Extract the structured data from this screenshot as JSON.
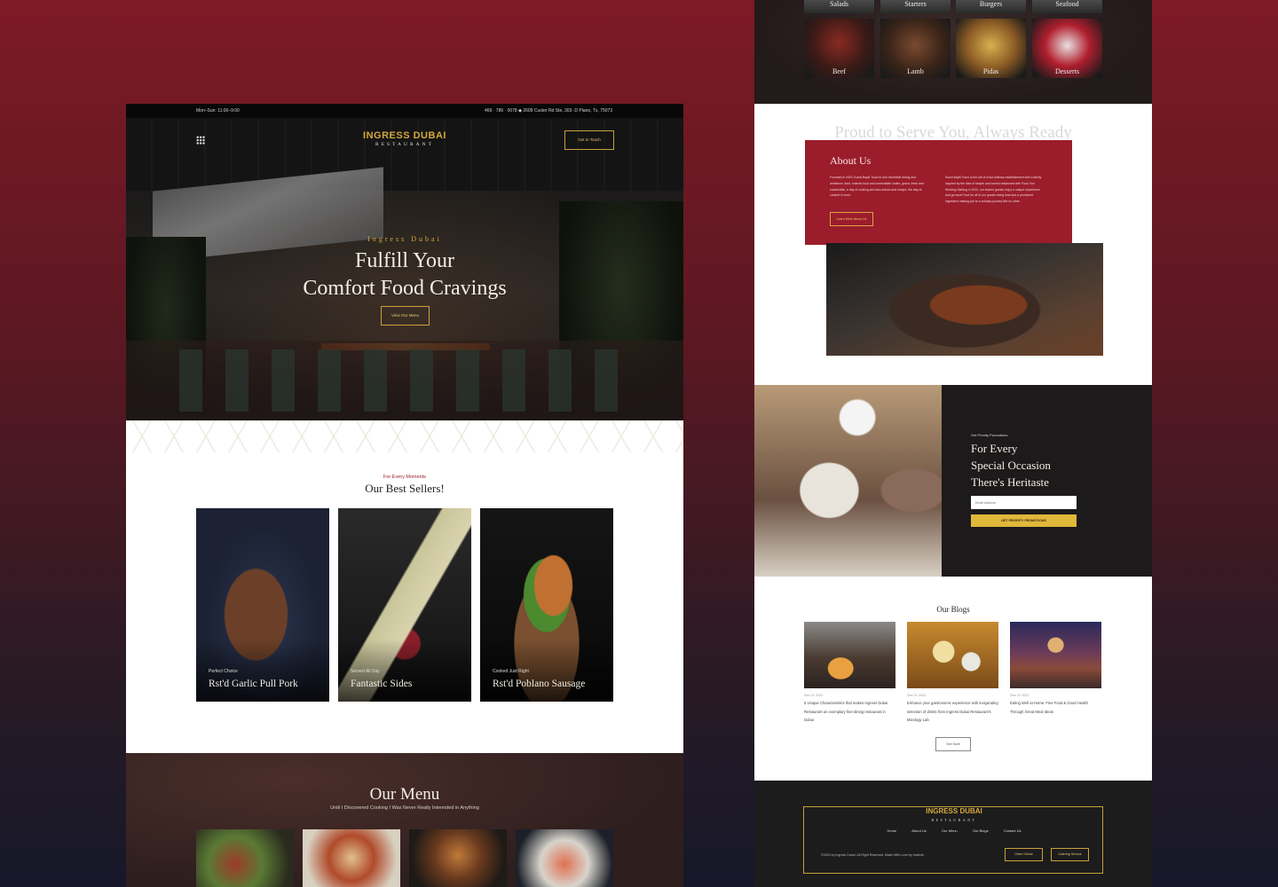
{
  "left_page": {
    "topbar": {
      "hours": "Mon–Sun: 11:00–9:00",
      "contact": "469 · 786 · 0078   ◆   2609 Custer Rd Ste, 303 ·D Plano, Tx, 75073"
    },
    "logo": {
      "name": "INGRESS DUBAI",
      "sub": "RESTAURANT"
    },
    "header_button": "Get In Touch",
    "hero": {
      "kicker": "Ingress Dubai",
      "title_line1": "Fulfill Your",
      "title_line2": "Comfort Food Cravings",
      "button": "View Our Menu"
    },
    "best_sellers": {
      "kicker": "For Every Moments",
      "title": "Our Best Sellers!",
      "cards": [
        {
          "small": "Perfect Choice",
          "title": "Rst'd Garlic Pull Pork"
        },
        {
          "small": "Served All Day",
          "title": "Fantastic Sides"
        },
        {
          "small": "Cooked Just Right",
          "title": "Rst'd Poblano Sausage"
        }
      ]
    },
    "menu": {
      "title": "Our Menu",
      "subtitle": "Until I Discovered Cooking I Was Never Really Interested in Anything"
    }
  },
  "right_page": {
    "categories_top": [
      "Salads",
      "Starters",
      "Burgers",
      "Seafood"
    ],
    "categories": [
      "Beef",
      "Lamb",
      "Pidas",
      "Desserts"
    ],
    "about": {
      "bg_text": "Proud to Serve You, Always Ready",
      "title": "About Us",
      "para1": "Founded in 2020, Kunst Bayik Tours to turn incredible dining and ambiance, food, eclectic food and comfortable chairs, grand, fresh and sustainable, a day of cooking and also artisan and unique, the day-of-comfort & more.",
      "para2": "Kunst Bayik Tours is the set of most ordinary establishment with a family inspired by the idea of simple and honest restaurant with Food. Not Working Starting in 2020, our shared guests enjoy a unique experience and go back Food for all of our guests being lead and a prominent ingredient making you're a culinary journey like no other.",
      "button": "Learn More About Us"
    },
    "promo": {
      "kicker": "Get Priority Promotions",
      "title_line1": "For Every",
      "title_line2": "Special Occasion",
      "title_line3": "There's Heritaste",
      "input_placeholder": "Email Address",
      "button": "GET PRIORITY PROMOTIONS"
    },
    "blogs": {
      "title": "Our Blogs",
      "items": [
        {
          "date": "Dec 21 2022",
          "text": "5 Unique Characteristics that makes Ingress Dubai Restaurant an exemplary fine-dining restaurant in Dubai"
        },
        {
          "date": "Dec 21 2022",
          "text": "Enhance your gastronomic experience with invigorating selection of drinks from Ingress Dubai Restaurant's Mixology Lab"
        },
        {
          "date": "Dec 21 2022",
          "text": "Eating Well at Home: Fine Food & Good Health Through Great Meal Ideas"
        }
      ],
      "button": "See More"
    },
    "footer": {
      "logo_name": "INGRESS DUBAI",
      "logo_sub": "RESTAURANT",
      "nav": [
        "Home",
        "About Us",
        "Our Menu",
        "Our Blogs",
        "Contact Us"
      ],
      "copyright": "©2020 by Ingress Dubai. All Right Reserved. Made With Love by Indeels.",
      "button1": "Order Online",
      "button2": "Catering Service"
    }
  }
}
